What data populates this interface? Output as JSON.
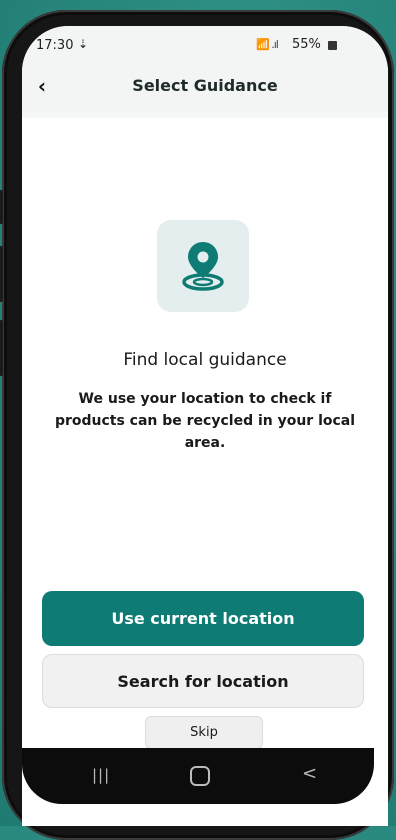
{
  "status_bar": {
    "time": "17:30",
    "download_indicator": "⇣",
    "signal_icons": "📶 .ıl",
    "battery_percent": "55%"
  },
  "app_bar": {
    "back_icon": "chevron-left",
    "title": "Select Guidance"
  },
  "main": {
    "icon": "location-pin-icon",
    "heading": "Find local guidance",
    "description": "We use your location to check if products can be recycled in your local area."
  },
  "actions": {
    "primary_label": "Use current location",
    "secondary_label": "Search for location",
    "skip_label": "Skip"
  },
  "nav_bar": {
    "recent_icon": "|||",
    "home_icon": "home-outline",
    "back_icon": "<"
  },
  "colors": {
    "accent": "#0e7c74",
    "icon_bg": "#e4eeee",
    "secondary_bg": "#f1f1f1"
  }
}
